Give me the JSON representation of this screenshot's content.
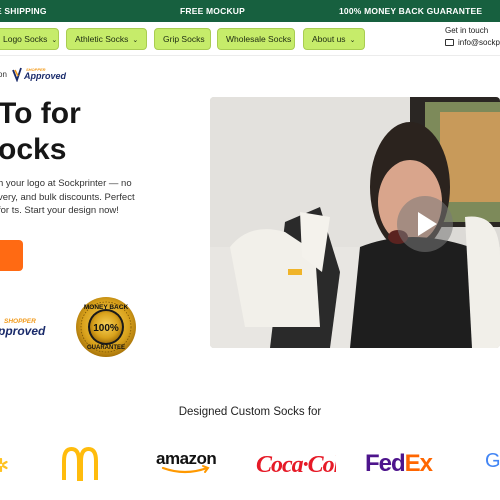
{
  "topbar": {
    "shipping": "E SHIPPING",
    "mockup": "FREE MOCKUP",
    "guarantee": "100% MONEY BACK GUARANTEE",
    "bg_color": "#17603f"
  },
  "nav": {
    "items": [
      {
        "label": "Logo Socks",
        "chevron": "⌄"
      },
      {
        "label": "Athletic Socks",
        "chevron": "⌄"
      },
      {
        "label": "Grip Socks",
        "chevron": ""
      },
      {
        "label": "Wholesale Socks",
        "chevron": ""
      },
      {
        "label": "About us",
        "chevron": "⌄"
      }
    ],
    "pill_color": "#c6ec6a",
    "contact_title": "Get in touch",
    "contact_email": "info@sockp"
  },
  "logo_row": {
    "prefix": "on",
    "shopper_small": "SHOPPER",
    "approved": "Approved"
  },
  "hero": {
    "title_line1": "To for",
    "title_line2": "ocks",
    "description": "h your logo at Sockprinter — no very, and bulk discounts. Perfect for ts. Start your design now!",
    "cta_color": "#ff6a13"
  },
  "badges": {
    "shopper": "SHOPPER",
    "approved": "pproved",
    "money_back_top": "MONEY BACK",
    "money_back_pct": "100%",
    "money_back_bottom": "GUARANTEE"
  },
  "video": {
    "play_icon": "play-icon"
  },
  "clients": {
    "title": "Designed Custom Socks for",
    "brands": {
      "amazon": "amazon",
      "coke": "Coca·Cola",
      "fedex_fed": "Fed",
      "fedex_ex": "Ex",
      "google": "G"
    }
  }
}
